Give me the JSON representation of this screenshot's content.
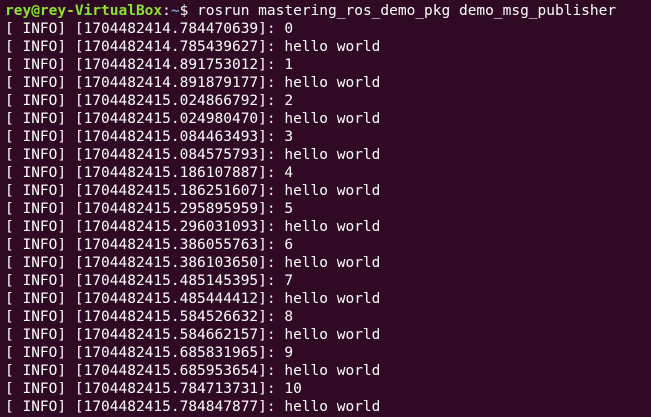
{
  "prompt": {
    "user_host": "rey@rey-VirtualBox",
    "separator": ":",
    "cwd": "~",
    "symbol": "$ ",
    "command": "rosrun mastering_ros_demo_pkg demo_msg_publisher"
  },
  "colors": {
    "background": "#300a24",
    "text": "#ffffff",
    "user_host": "#8ae234",
    "cwd": "#729fcf"
  },
  "output_lines": [
    "[ INFO] [1704482414.784470639]: 0",
    "[ INFO] [1704482414.785439627]: hello world",
    "[ INFO] [1704482414.891753012]: 1",
    "[ INFO] [1704482414.891879177]: hello world",
    "[ INFO] [1704482415.024866792]: 2",
    "[ INFO] [1704482415.024980470]: hello world",
    "[ INFO] [1704482415.084463493]: 3",
    "[ INFO] [1704482415.084575793]: hello world",
    "[ INFO] [1704482415.186107887]: 4",
    "[ INFO] [1704482415.186251607]: hello world",
    "[ INFO] [1704482415.295895959]: 5",
    "[ INFO] [1704482415.296031093]: hello world",
    "[ INFO] [1704482415.386055763]: 6",
    "[ INFO] [1704482415.386103650]: hello world",
    "[ INFO] [1704482415.485145395]: 7",
    "[ INFO] [1704482415.485444412]: hello world",
    "[ INFO] [1704482415.584526632]: 8",
    "[ INFO] [1704482415.584662157]: hello world",
    "[ INFO] [1704482415.685831965]: 9",
    "[ INFO] [1704482415.685953654]: hello world",
    "[ INFO] [1704482415.784713731]: 10",
    "[ INFO] [1704482415.784847877]: hello world"
  ]
}
